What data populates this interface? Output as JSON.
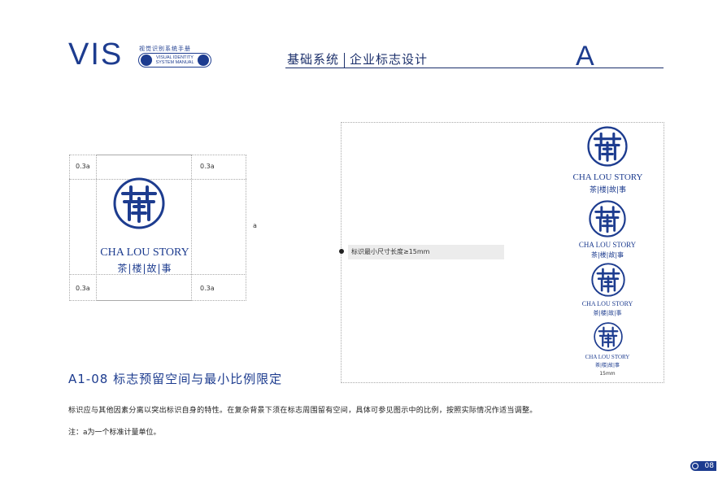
{
  "header": {
    "vis": "VIS",
    "manual_cn": "视觉识别系统手册",
    "manual_en_line1": "VISUAL IDENTITY",
    "manual_en_line2": "SYSTEM MANUAL",
    "section_main": "基础系统",
    "section_sub": "企业标志设计",
    "section_letter": "A"
  },
  "diagram": {
    "label_tl": "0.3a",
    "label_tr": "0.3a",
    "label_bl": "0.3a",
    "label_br": "0.3a",
    "label_a": "a",
    "brand_en": "CHA LOU STORY",
    "brand_cn": "茶|楼|故|事"
  },
  "min_size": {
    "label": "标识最小尺寸长度≥15mm",
    "bottom_label": "15mm"
  },
  "logos": [
    {
      "en": "CHA LOU STORY",
      "cn": "茶|楼|故|事"
    },
    {
      "en": "CHA LOU STORY",
      "cn": "茶|楼|故|事"
    },
    {
      "en": "CHA LOU STORY",
      "cn": "茶|楼|故|事"
    },
    {
      "en": "CHA LOU STORY",
      "cn": "茶|楼|故|事"
    }
  ],
  "section": {
    "title": "A1-08  标志预留空间与最小比例限定",
    "body": "标识应与其他因素分离以突出标识自身的特性。在复杂背景下须在标志周围留有空间，具体可参见图示中的比例，按照实际情况作适当调整。",
    "note": "注：a为一个标准计量单位。"
  },
  "page": {
    "number": "08"
  },
  "colors": {
    "brand": "#1d3c8f"
  }
}
